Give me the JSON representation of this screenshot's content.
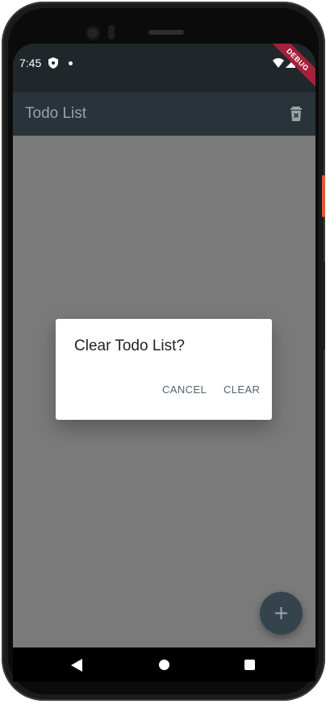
{
  "status_bar": {
    "time": "7:45",
    "debug_label": "DEBUG"
  },
  "app_bar": {
    "title": "Todo List",
    "action_icon": "delete-sweep-icon"
  },
  "dialog": {
    "title": "Clear Todo List?",
    "cancel_label": "CANCEL",
    "clear_label": "CLEAR"
  },
  "fab": {
    "icon": "plus-icon"
  },
  "nav": {
    "back_icon": "back-triangle-icon",
    "home_icon": "home-circle-icon",
    "recents_icon": "recents-square-icon"
  },
  "colors": {
    "app_bar": "#29333a",
    "status_bar": "#1f272a",
    "scrim": "#7a7a7a",
    "accent": "#4f6672",
    "fab": "#35444c",
    "debug_ribbon": "#a5203a"
  }
}
